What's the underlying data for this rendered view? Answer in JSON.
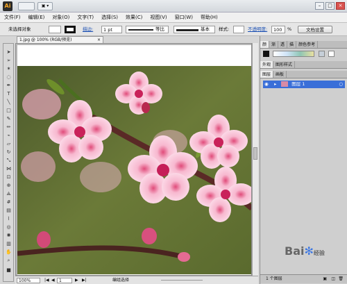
{
  "titlebar": {
    "logo": "Ai",
    "br_label": "▣ ▾"
  },
  "menu": [
    "文件(F)",
    "编辑(E)",
    "对象(O)",
    "文字(T)",
    "选择(S)",
    "效果(C)",
    "视图(V)",
    "窗口(W)",
    "帮助(H)"
  ],
  "control": {
    "selection": "未选择对象",
    "stroke_label": "描边:",
    "stroke_weight": "1 pt",
    "stroke_profile": "等比",
    "brush": "基本",
    "style_label": "样式:",
    "opacity_label": "不透明度:",
    "opacity_value": "100",
    "opacity_unit": "%",
    "doc_setup": "文档设置"
  },
  "doc": {
    "tab_title": "1.jpg @ 100% (RGB/预览)"
  },
  "status": {
    "zoom": "100%",
    "page": "1",
    "info": "编组选择"
  },
  "panels": {
    "color_tabs": [
      "颜",
      "渐",
      "透",
      "描",
      "颜色参考"
    ],
    "appearance_tabs": [
      "外观",
      "图形样式"
    ],
    "layer_tabs": [
      "图层",
      "画板"
    ],
    "layer_name": "图层 1",
    "layer_count": "1 个图层"
  },
  "watermark": {
    "text": "Bai",
    "suffix": "经验"
  }
}
